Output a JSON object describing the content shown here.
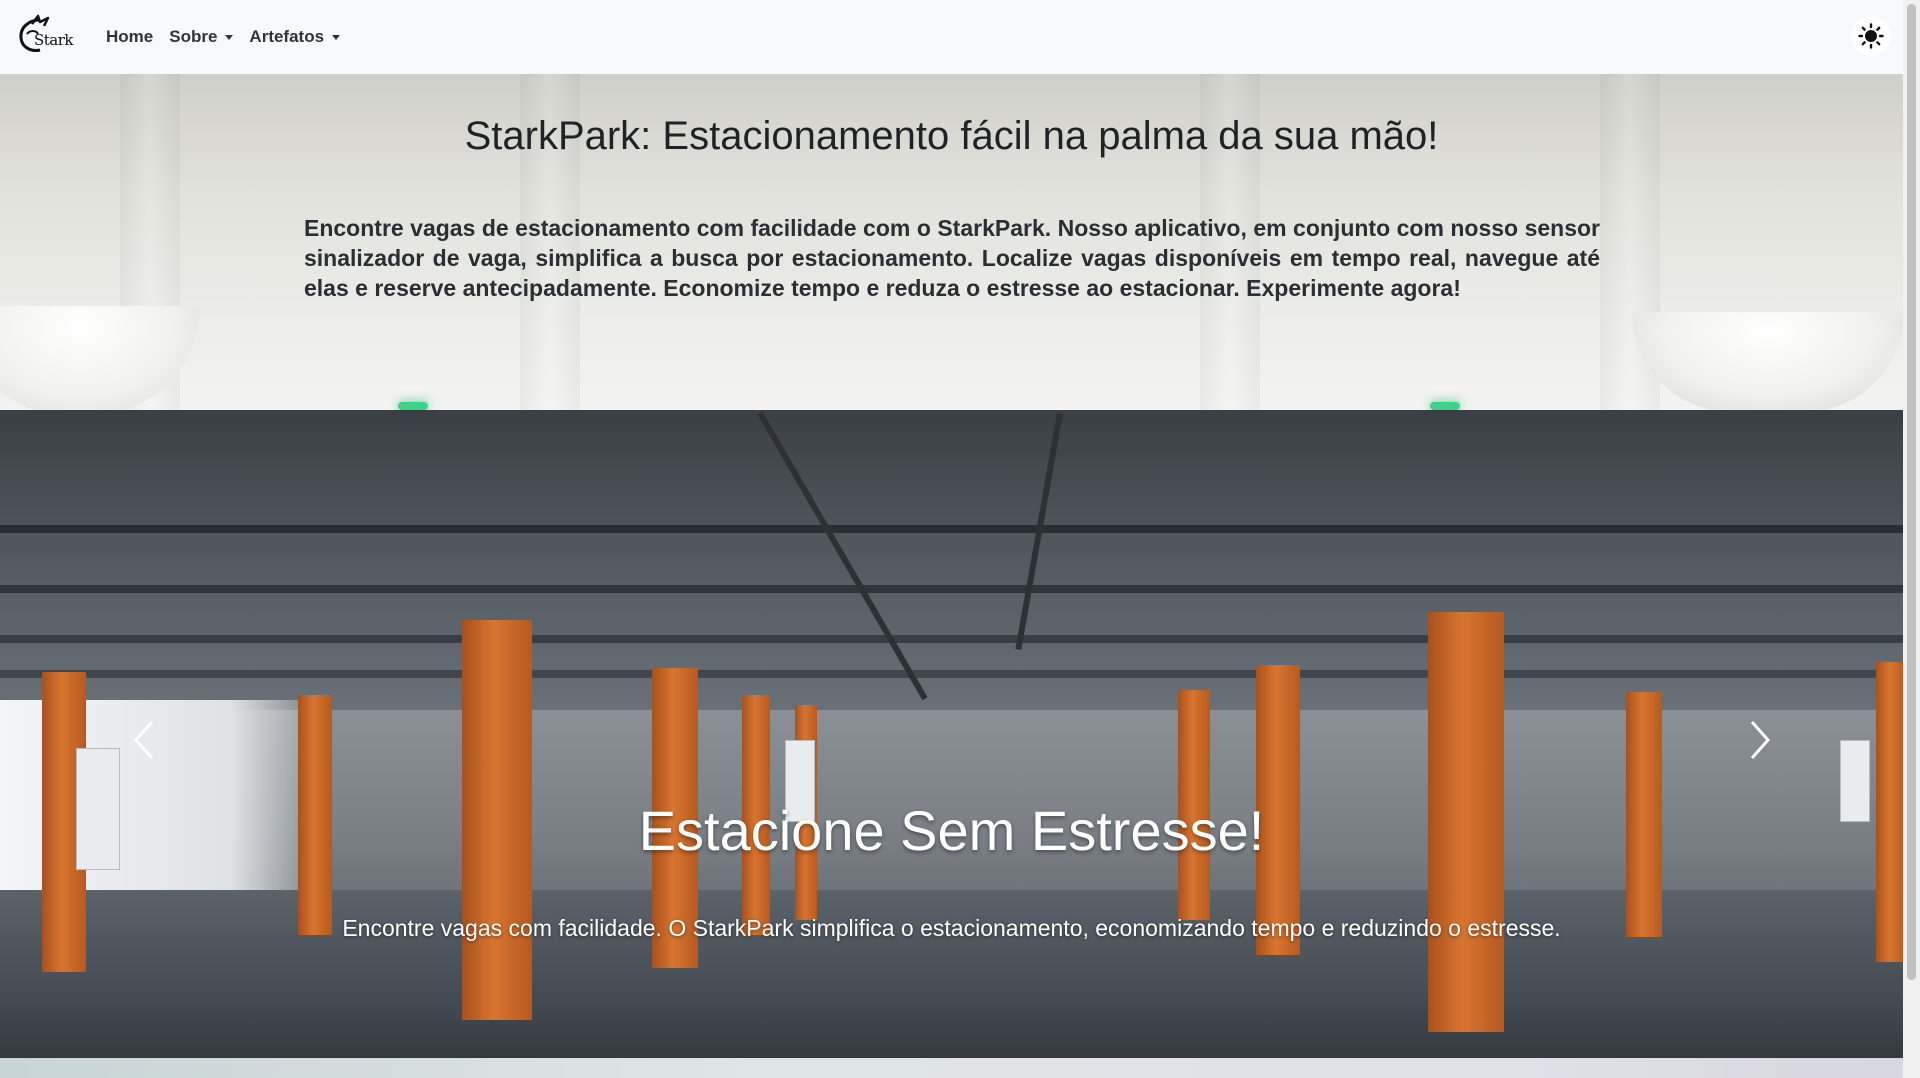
{
  "navbar": {
    "brand_text": "Stark",
    "links": [
      {
        "label": "Home"
      },
      {
        "label": "Sobre"
      },
      {
        "label": "Artefatos"
      }
    ]
  },
  "intro": {
    "title": "StarkPark: Estacionamento fácil na palma da sua mão!",
    "text": "Encontre vagas de estacionamento com facilidade com o StarkPark. Nosso aplicativo, em conjunto com nosso sensor sinalizador de vaga, simplifica a busca por estacionamento. Localize vagas disponíveis em tempo real, navegue até elas e reserve antecipadamente. Economize tempo e reduza o estresse ao estacionar. Experimente agora!"
  },
  "carousel": {
    "slide_title": "Estacione Sem Estresse!",
    "slide_text": "Encontre vagas com facilidade. O StarkPark simplifica o estacionamento, economizando tempo e reduzindo o estresse."
  },
  "icons": {
    "theme_toggle": "sun-icon",
    "prev": "chevron-left-icon",
    "next": "chevron-right-icon",
    "logo": "stark-logo-icon"
  }
}
